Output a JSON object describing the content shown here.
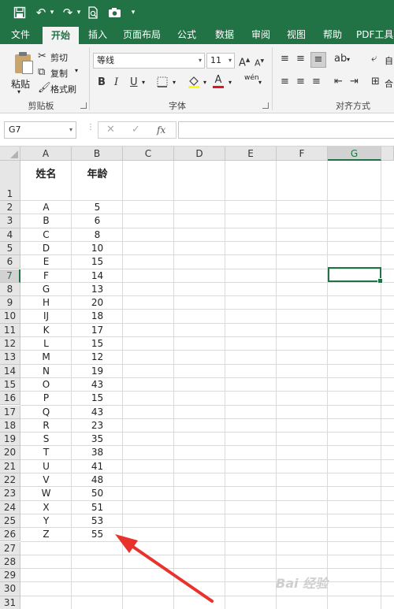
{
  "quick_access": {
    "overflow": "▾"
  },
  "tabs": [
    {
      "label": "文件",
      "active": false
    },
    {
      "label": "开始",
      "active": true
    },
    {
      "label": "插入",
      "active": false
    },
    {
      "label": "页面布局",
      "active": false
    },
    {
      "label": "公式",
      "active": false
    },
    {
      "label": "数据",
      "active": false
    },
    {
      "label": "审阅",
      "active": false
    },
    {
      "label": "视图",
      "active": false
    },
    {
      "label": "帮助",
      "active": false
    },
    {
      "label": "PDF工具",
      "active": false
    }
  ],
  "ribbon": {
    "clipboard": {
      "paste": "粘贴",
      "cut": "剪切",
      "copy": "复制",
      "format_painter": "格式刷",
      "group_label": "剪贴板"
    },
    "font": {
      "font_name": "等线",
      "font_size": "11",
      "group_label": "字体",
      "bold": "B",
      "italic": "I",
      "underline": "U",
      "wen": "wén",
      "increase": "A",
      "decrease": "A"
    },
    "alignment": {
      "group_label": "对齐方式",
      "wrap": "自",
      "merge": "合"
    }
  },
  "formula_bar": {
    "name_box": "G7",
    "formula": ""
  },
  "grid": {
    "columns": [
      "A",
      "B",
      "C",
      "D",
      "E",
      "F",
      "G"
    ],
    "selected_column": "G",
    "selected_row": 7,
    "rows": [
      "1",
      "2",
      "3",
      "4",
      "5",
      "6",
      "7",
      "8",
      "9",
      "10",
      "11",
      "12",
      "13",
      "14",
      "15",
      "16",
      "17",
      "18",
      "19",
      "20",
      "21",
      "22",
      "23",
      "24",
      "25",
      "26",
      "27",
      "28",
      "29",
      "30",
      "31"
    ],
    "header": {
      "name": "姓名",
      "age": "年龄"
    },
    "data": [
      {
        "name": "A",
        "age": "5"
      },
      {
        "name": "B",
        "age": "6"
      },
      {
        "name": "C",
        "age": "8"
      },
      {
        "name": "D",
        "age": "10"
      },
      {
        "name": "E",
        "age": "15"
      },
      {
        "name": "F",
        "age": "14"
      },
      {
        "name": "G",
        "age": "13"
      },
      {
        "name": "H",
        "age": "20"
      },
      {
        "name": "IJ",
        "age": "18"
      },
      {
        "name": "K",
        "age": "17"
      },
      {
        "name": "L",
        "age": "15"
      },
      {
        "name": "M",
        "age": "12"
      },
      {
        "name": "N",
        "age": "19"
      },
      {
        "name": "O",
        "age": "43"
      },
      {
        "name": "P",
        "age": "15"
      },
      {
        "name": "Q",
        "age": "43"
      },
      {
        "name": "R",
        "age": "23"
      },
      {
        "name": "S",
        "age": "35"
      },
      {
        "name": "T",
        "age": "38"
      },
      {
        "name": "U",
        "age": "41"
      },
      {
        "name": "V",
        "age": "48"
      },
      {
        "name": "W",
        "age": "50"
      },
      {
        "name": "X",
        "age": "51"
      },
      {
        "name": "Y",
        "age": "53"
      },
      {
        "name": "Z",
        "age": "55"
      }
    ]
  },
  "annotation": {
    "arrow_color": "#e8322b"
  },
  "watermark": "Bai 经验",
  "colors": {
    "brand": "#217346",
    "accent": "#217346",
    "arrow": "#e8322b"
  }
}
